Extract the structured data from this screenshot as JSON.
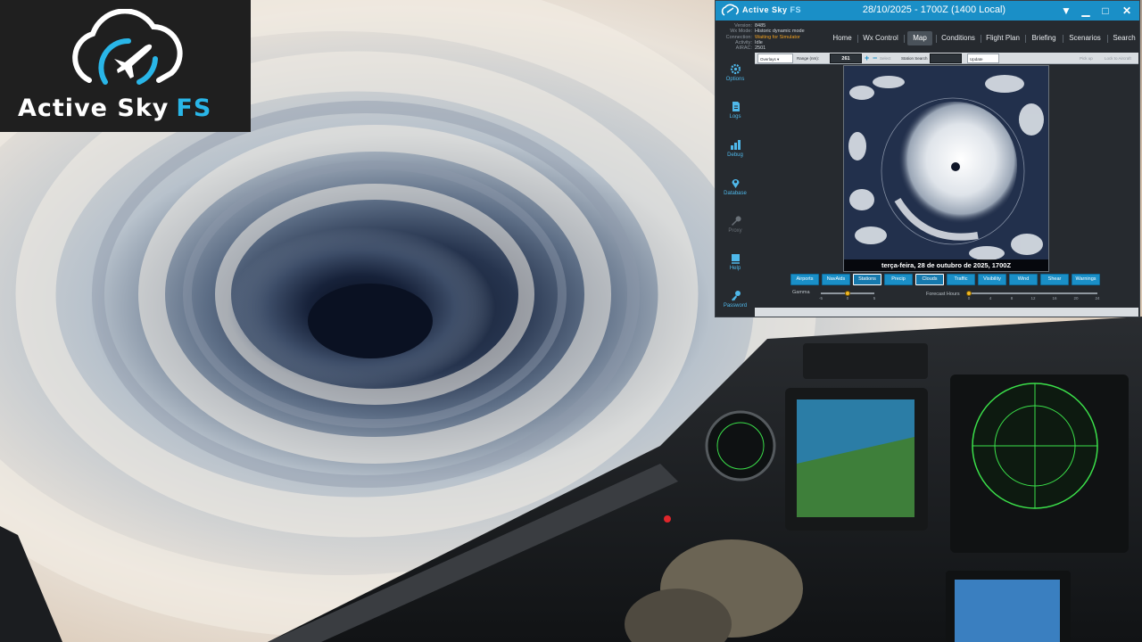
{
  "logo": {
    "word1": "Active Sky",
    "word2": "FS",
    "accent": "#29b6e8"
  },
  "app": {
    "brand": "Active Sky",
    "brand_suffix": "FS",
    "title": "28/10/2025 - 1700Z (1400 Local)",
    "window_buttons": [
      "dropdown-icon",
      "minimize-icon",
      "maximize-icon",
      "close-icon"
    ],
    "info": [
      {
        "key": "Version:",
        "value": "8485",
        "warn": false
      },
      {
        "key": "Wx Mode:",
        "value": "Historic dynamic mode",
        "warn": false
      },
      {
        "key": "Connection:",
        "value": "Waiting for Simulator",
        "warn": true
      },
      {
        "key": "Activity:",
        "value": "Idle",
        "warn": false
      },
      {
        "key": "AIRAC:",
        "value": "2501",
        "warn": false
      }
    ],
    "sidebar": [
      {
        "label": "Options",
        "icon": "gear-icon",
        "enabled": true
      },
      {
        "label": "Logs",
        "icon": "document-icon",
        "enabled": true
      },
      {
        "label": "Debug",
        "icon": "bar-chart-icon",
        "enabled": true
      },
      {
        "label": "Database",
        "icon": "location-pin-icon",
        "enabled": true
      },
      {
        "label": "Proxy",
        "icon": "wrench-icon",
        "enabled": false
      },
      {
        "label": "Help",
        "icon": "book-icon",
        "enabled": true
      },
      {
        "label": "Password",
        "icon": "key-icon",
        "enabled": true
      }
    ],
    "nav": [
      {
        "label": "Home",
        "active": false
      },
      {
        "label": "Wx Control",
        "active": false
      },
      {
        "label": "Map",
        "active": true
      },
      {
        "label": "Conditions",
        "active": false
      },
      {
        "label": "Flight Plan",
        "active": false
      },
      {
        "label": "Briefing",
        "active": false
      },
      {
        "label": "Scenarios",
        "active": false
      },
      {
        "label": "Search",
        "active": false
      }
    ],
    "toolbar": {
      "overlay_select": "Overlays",
      "range_label": "Range (nm):",
      "range_value": "261",
      "select_label": "Select",
      "station_search_label": "Station Search",
      "station_search_value": "",
      "update_label": "Update",
      "pick_up_label": "Pick up",
      "lock_to_aircraft_label": "Lock to Aircraft"
    },
    "map_caption": "terça-feira, 28 de outubro de 2025, 1700Z",
    "layers": [
      {
        "label": "Airports",
        "on": false
      },
      {
        "label": "NavAids",
        "on": false
      },
      {
        "label": "Stations",
        "on": true
      },
      {
        "label": "Precip",
        "on": false
      },
      {
        "label": "Clouds",
        "on": true
      },
      {
        "label": "Traffic",
        "on": false
      },
      {
        "label": "Visibility",
        "on": false
      },
      {
        "label": "Wind",
        "on": false
      },
      {
        "label": "Shear",
        "on": false
      },
      {
        "label": "Warnings",
        "on": false
      }
    ],
    "gamma": {
      "label": "Gamma",
      "ticks": [
        "-5",
        "0",
        "5"
      ],
      "value": 0
    },
    "forecast": {
      "label": "Forecast Hours",
      "ticks": [
        "0",
        "4",
        "8",
        "12",
        "16",
        "20",
        "24"
      ],
      "value": 0
    }
  }
}
